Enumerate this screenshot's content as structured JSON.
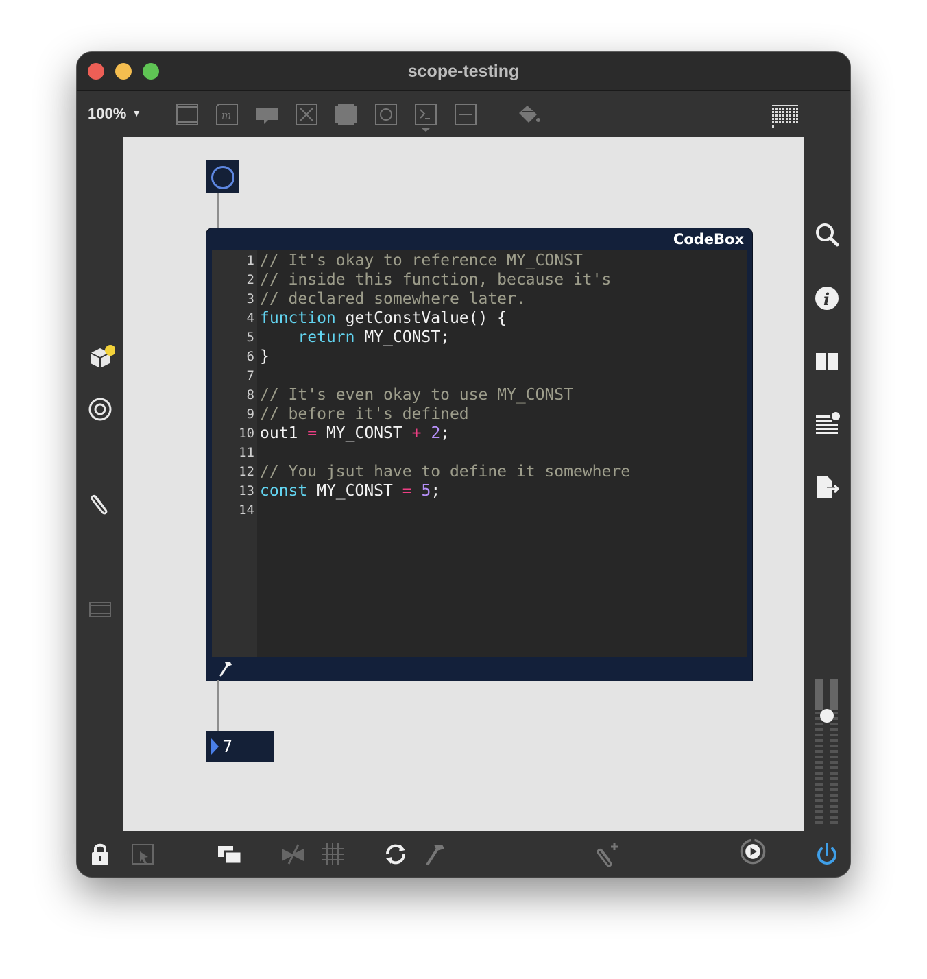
{
  "window": {
    "title": "scope-testing"
  },
  "toolbar": {
    "zoom_label": "100%",
    "icons": [
      "object-box-icon",
      "message-box-icon",
      "comment-icon",
      "toggle-icon",
      "matrix-icon",
      "button-icon",
      "number-icon",
      "slider-icon",
      "paint-bucket-icon",
      "grid-keyboard-icon"
    ]
  },
  "codebox": {
    "label": "CodeBox",
    "lines": [
      {
        "n": "1",
        "tokens": [
          {
            "t": "// It's okay to reference MY_CONST",
            "c": "cm"
          }
        ]
      },
      {
        "n": "2",
        "tokens": [
          {
            "t": "// inside this function, because it's",
            "c": "cm"
          }
        ]
      },
      {
        "n": "3",
        "tokens": [
          {
            "t": "// declared somewhere later.",
            "c": "cm"
          }
        ]
      },
      {
        "n": "4",
        "tokens": [
          {
            "t": "function",
            "c": "kw"
          },
          {
            "t": " getConstValue() {",
            "c": "pl"
          }
        ]
      },
      {
        "n": "5",
        "tokens": [
          {
            "t": "    ",
            "c": "pl"
          },
          {
            "t": "return",
            "c": "kw"
          },
          {
            "t": " MY_CONST;",
            "c": "pl"
          }
        ]
      },
      {
        "n": "6",
        "tokens": [
          {
            "t": "}",
            "c": "pl"
          }
        ]
      },
      {
        "n": "7",
        "tokens": []
      },
      {
        "n": "8",
        "tokens": [
          {
            "t": "// It's even okay to use MY_CONST",
            "c": "cm"
          }
        ]
      },
      {
        "n": "9",
        "tokens": [
          {
            "t": "// before it's defined",
            "c": "cm"
          }
        ]
      },
      {
        "n": "10",
        "tokens": [
          {
            "t": "out1 ",
            "c": "pl"
          },
          {
            "t": "=",
            "c": "op"
          },
          {
            "t": " MY_CONST ",
            "c": "pl"
          },
          {
            "t": "+",
            "c": "op"
          },
          {
            "t": " ",
            "c": "pl"
          },
          {
            "t": "2",
            "c": "num"
          },
          {
            "t": ";",
            "c": "pl"
          }
        ]
      },
      {
        "n": "11",
        "tokens": []
      },
      {
        "n": "12",
        "tokens": [
          {
            "t": "// You jsut have to define it somewhere",
            "c": "cm"
          }
        ]
      },
      {
        "n": "13",
        "tokens": [
          {
            "t": "const",
            "c": "kw"
          },
          {
            "t": " MY_CONST ",
            "c": "pl"
          },
          {
            "t": "=",
            "c": "op"
          },
          {
            "t": " ",
            "c": "pl"
          },
          {
            "t": "5",
            "c": "num"
          },
          {
            "t": ";",
            "c": "pl"
          }
        ]
      },
      {
        "n": "14",
        "tokens": []
      }
    ]
  },
  "number_box": {
    "value": "7"
  },
  "colors": {
    "object_bg": "#142037",
    "button_ring": "#5d86e0",
    "comment": "#9d9d8b",
    "keyword": "#62d4f0",
    "operator": "#ee3f84",
    "number": "#b48ef6",
    "power_blue": "#3f9fe8",
    "badge_yellow": "#f3d23a"
  }
}
